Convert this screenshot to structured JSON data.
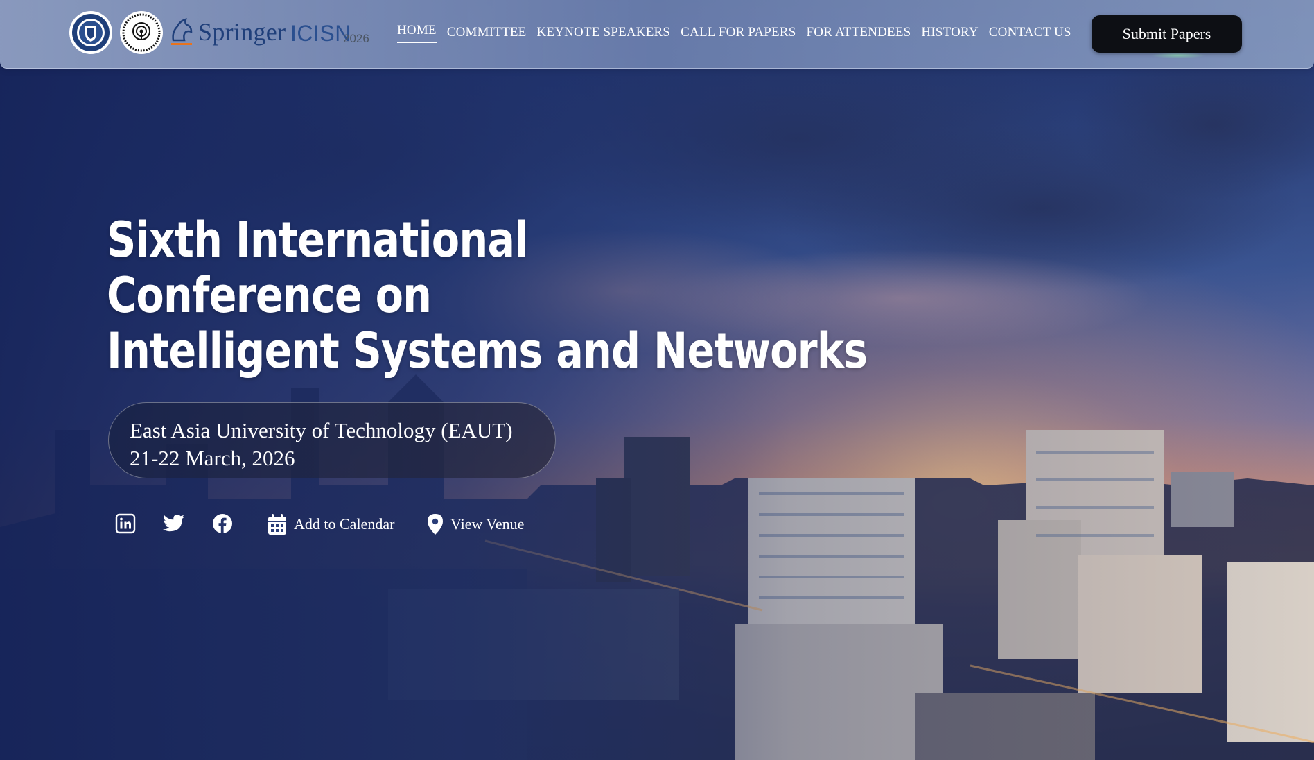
{
  "header": {
    "springer_logo_text": "Springer",
    "conference_logo_text": "ICISN",
    "conference_year": "2026",
    "nav": [
      {
        "label": "HOME"
      },
      {
        "label": "COMMITTEE"
      },
      {
        "label": "KEYNOTE SPEAKERS"
      },
      {
        "label": "CALL FOR PAPERS"
      },
      {
        "label": "FOR ATTENDEES"
      },
      {
        "label": "HISTORY"
      },
      {
        "label": "CONTACT US"
      }
    ],
    "active_nav": "HOME",
    "submit_button": "Submit Papers"
  },
  "hero": {
    "title_lines": [
      "Sixth International",
      "Conference on",
      "Intelligent Systems and Networks"
    ],
    "venue": "East Asia University of Technology (EAUT)",
    "dates": "21-22 March, 2026",
    "social_icons": [
      "linkedin-icon",
      "twitter-icon",
      "facebook-icon"
    ],
    "add_to_calendar": "Add to Calendar",
    "view_venue": "View Venue"
  },
  "colors": {
    "header_bg": "#8c9cc4",
    "button_bg": "#0d0f14",
    "text_primary": "#ffffff",
    "springer_blue": "#1f3f7a",
    "sky_top": "#1b2b63",
    "sunset_glow": "#d99a6a"
  },
  "icons": {
    "eaut_seal": "eaut-seal-logo",
    "icisn_seal": "icisn-seal-logo",
    "springer_horse": "springer-horse-logo",
    "calendar": "calendar-icon",
    "location": "location-pin-icon"
  }
}
